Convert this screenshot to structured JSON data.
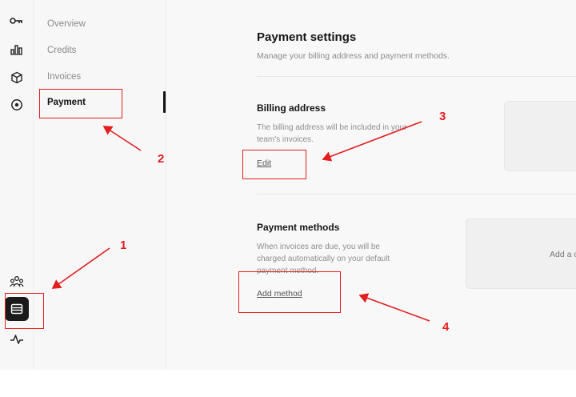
{
  "rail": {
    "icons": [
      "key-icon",
      "bar-chart-icon",
      "cube-icon",
      "target-icon",
      "team-icon",
      "billing-icon",
      "activity-icon"
    ]
  },
  "subnav": {
    "items": [
      {
        "label": "Overview"
      },
      {
        "label": "Credits"
      },
      {
        "label": "Invoices"
      },
      {
        "label": "Payment"
      }
    ],
    "active": "Payment"
  },
  "main": {
    "title": "Payment settings",
    "subtitle": "Manage your billing address and payment methods.",
    "billing": {
      "title": "Billing address",
      "description": "The billing address will be included in your team's invoices.",
      "link": "Edit"
    },
    "payment_methods": {
      "title": "Payment methods",
      "description": "When invoices are due, you will be charged automatically on your default payment method.",
      "link": "Add method",
      "card_text": "Add a c"
    }
  },
  "annotations": {
    "color": "#e31e1e",
    "callouts": [
      "1",
      "2",
      "3",
      "4"
    ]
  }
}
